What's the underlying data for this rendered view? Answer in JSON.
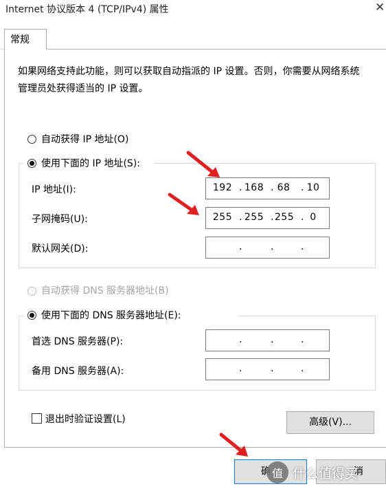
{
  "window": {
    "title": "Internet 协议版本 4 (TCP/IPv4) 属性",
    "close_glyph": "✕"
  },
  "tabs": [
    {
      "label": "常规"
    }
  ],
  "description": "如果网络支持此功能，则可以获取自动指派的 IP 设置。否则，你需要从网络系统管理员处获得适当的 IP 设置。",
  "ip": {
    "auto_label": "自动获得 IP 地址(O)",
    "manual_label": "使用下面的 IP 地址(S):",
    "selected": "manual",
    "fields": [
      {
        "label": "IP 地址(I):",
        "octets": [
          "192",
          "168",
          "68",
          "10"
        ]
      },
      {
        "label": "子网掩码(U):",
        "octets": [
          "255",
          "255",
          "255",
          "0"
        ]
      },
      {
        "label": "默认网关(D):",
        "octets": [
          "",
          "",
          "",
          ""
        ]
      }
    ]
  },
  "dns": {
    "auto_label": "自动获得 DNS 服务器地址(B)",
    "manual_label": "使用下面的 DNS 服务器地址(E):",
    "selected": "manual",
    "fields": [
      {
        "label": "首选 DNS 服务器(P):",
        "octets": [
          "",
          "",
          "",
          ""
        ]
      },
      {
        "label": "备用 DNS 服务器(A):",
        "octets": [
          "",
          "",
          "",
          ""
        ]
      }
    ]
  },
  "validate_on_exit": {
    "label": "退出时验证设置(L)",
    "checked": false
  },
  "advanced_button": "高级(V)...",
  "ok_button": "确",
  "cancel_button": "消",
  "watermark": {
    "badge": "值",
    "text": "什么值得买"
  },
  "colors": {
    "arrow": "#e02020",
    "accent_border": "#0078d7"
  }
}
